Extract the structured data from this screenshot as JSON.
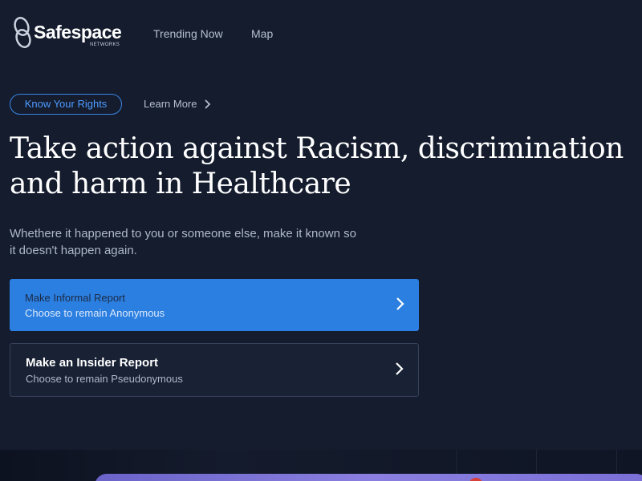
{
  "brand": {
    "name": "Safespace",
    "sub": "NETWORKS"
  },
  "nav": {
    "items": [
      "Trending Now",
      "Map"
    ]
  },
  "rights": {
    "pill_label": "Know Your Rights",
    "learn_more": "Learn More"
  },
  "hero": {
    "headline": "Take action against Racism, discrimination and harm in Healthcare",
    "subtext": "Whethere it happened to you or someone else, make it known so it doesn't happen again."
  },
  "reports": [
    {
      "title": "Make Informal Report",
      "subtitle": "Choose to remain Anonymous"
    },
    {
      "title": "Make an Insider Report",
      "subtitle": "Choose to remain Pseudonymous"
    }
  ],
  "colors": {
    "background": "#141c2e",
    "accent": "#2b7fe0",
    "accent_text": "#4f9bff",
    "card_dark": "#182234"
  },
  "icons": {
    "logo": "chain-link-logo-icon",
    "chevron": "chevron-right-icon"
  }
}
